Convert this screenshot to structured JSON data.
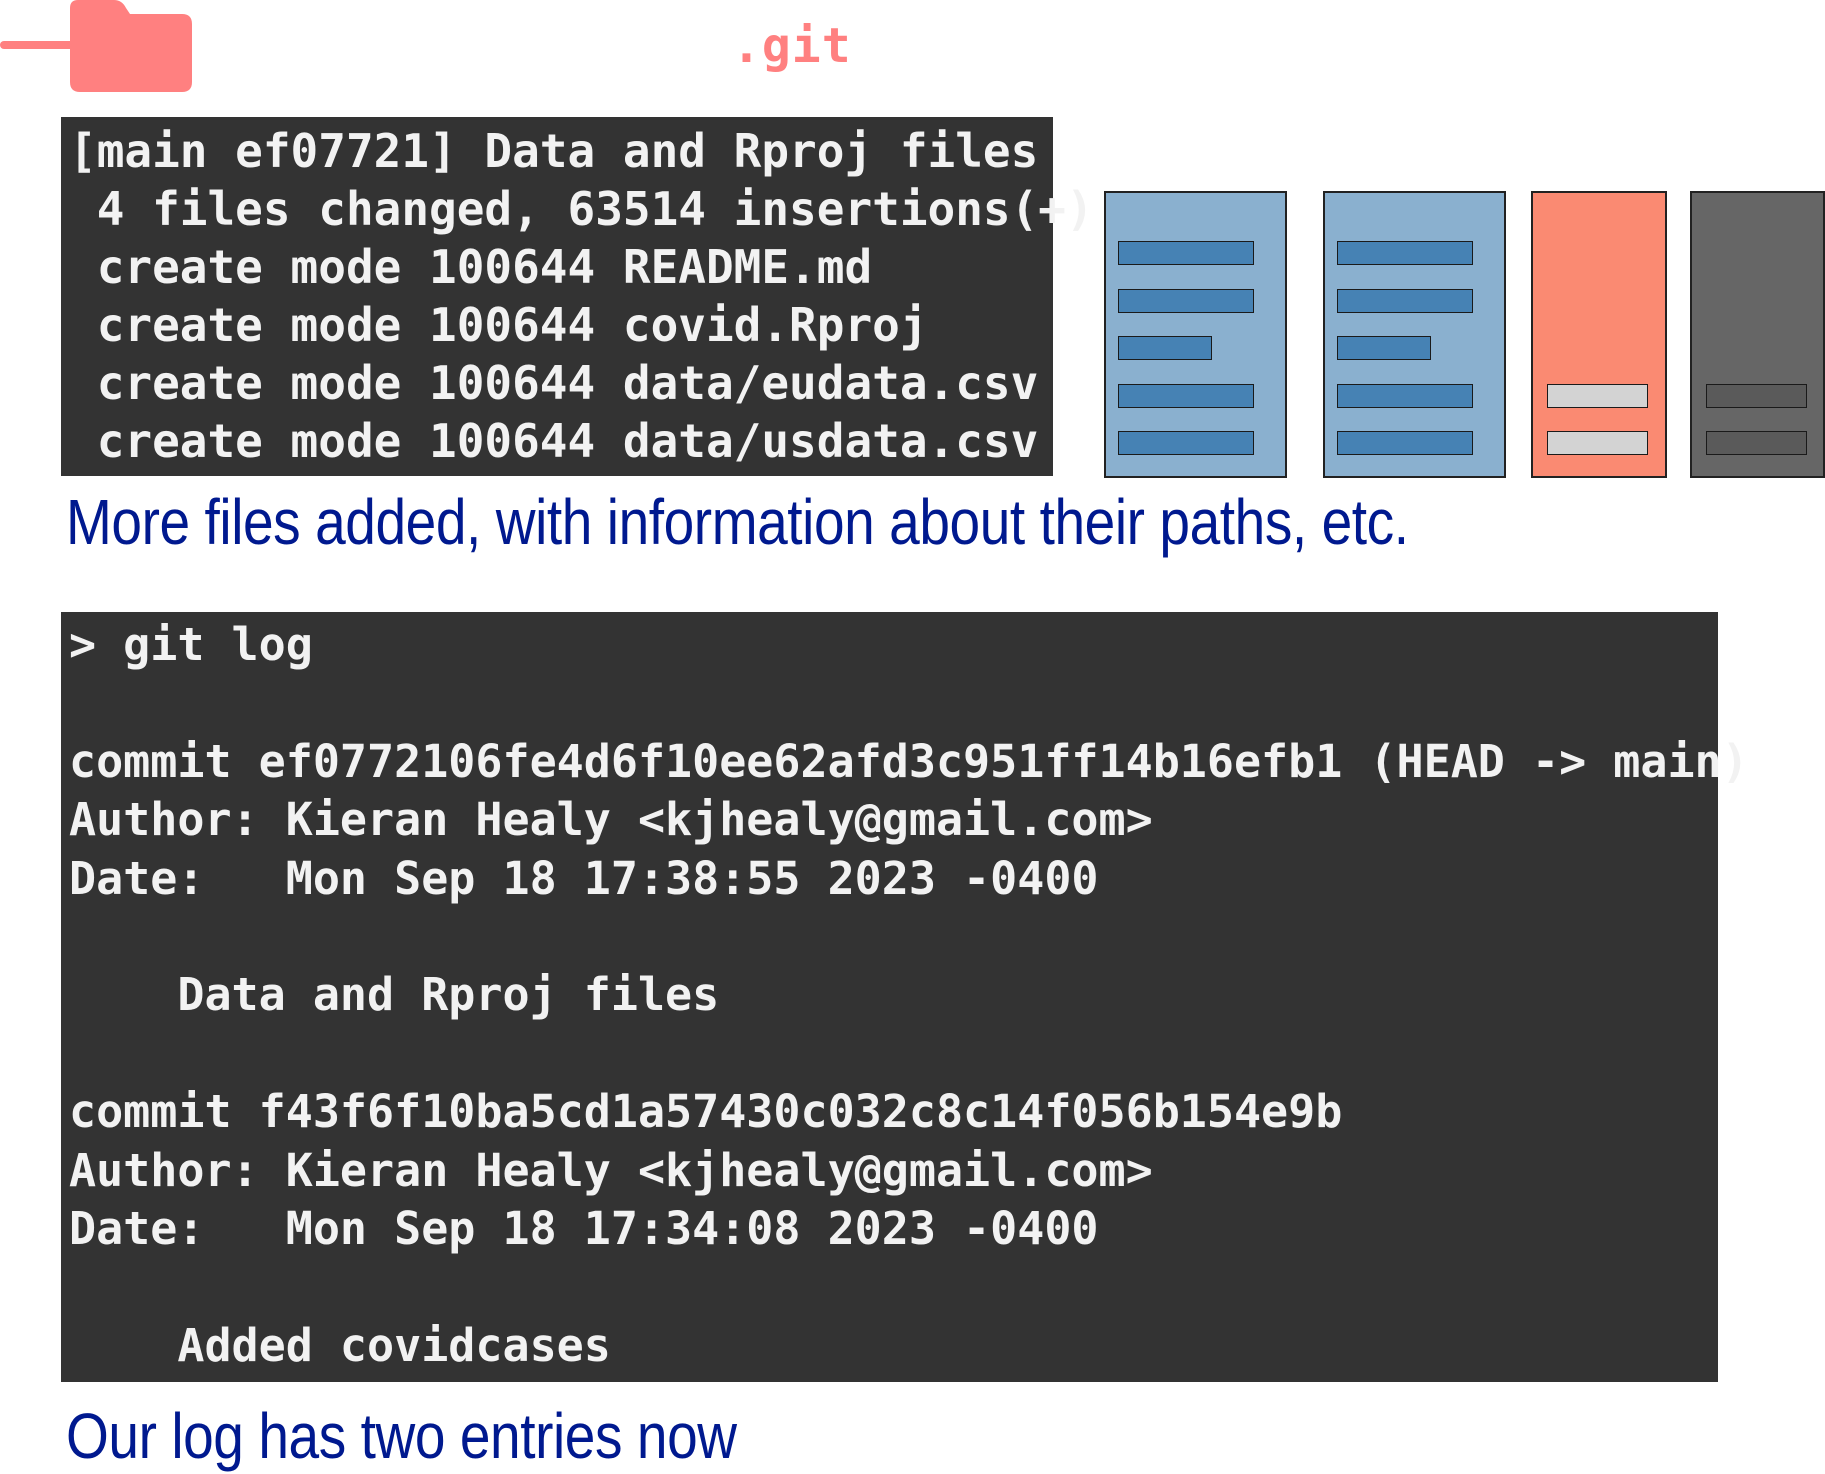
{
  "header": {
    "folder_name": ".git",
    "folder_icon": "folder-icon",
    "folder_color": "#ff8080"
  },
  "commit_output": {
    "lines": [
      "[main ef07721] Data and Rproj files",
      " 4 files changed, 63514 insertions(+)",
      " create mode 100644 README.md",
      " create mode 100644 covid.Rproj",
      " create mode 100644 data/eudata.csv",
      " create mode 100644 data/usdata.csv"
    ]
  },
  "caption_files": "More files added, with information about their paths, etc.",
  "file_cards": [
    {
      "icon": "document-icon",
      "color": "#8ab0cf",
      "bar_color": "#4682b4"
    },
    {
      "icon": "document-icon",
      "color": "#8ab0cf",
      "bar_color": "#4682b4"
    },
    {
      "icon": "document-icon",
      "color": "#fa8a72",
      "bar_color": "#d3d3d3"
    },
    {
      "icon": "document-icon",
      "color": "#666666",
      "bar_color": "#5a5a5a"
    }
  ],
  "git_log": {
    "lines": [
      "> git log",
      "",
      "commit ef0772106fe4d6f10ee62afd3c951ff14b16efb1 (HEAD -> main)",
      "Author: Kieran Healy <kjhealy@gmail.com>",
      "Date:   Mon Sep 18 17:38:55 2023 -0400",
      "",
      "    Data and Rproj files",
      "",
      "commit f43f6f10ba5cd1a57430c032c8c14f056b154e9b",
      "Author: Kieran Healy <kjhealy@gmail.com>",
      "Date:   Mon Sep 18 17:34:08 2023 -0400",
      "",
      "    Added covidcases"
    ]
  },
  "caption_log": "Our log has two entries now",
  "colors": {
    "terminal_bg": "#333333",
    "terminal_text": "#f2f2f2",
    "caption_text": "#00198f",
    "accent": "#ff8080"
  }
}
